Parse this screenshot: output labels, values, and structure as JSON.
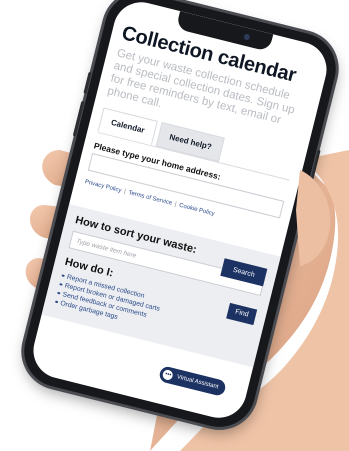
{
  "screen": {
    "title": "Collection calendar",
    "intro": "Get your waste collection schedule and special collection dates. Sign up for free reminders by text, email or phone call.",
    "tabs": [
      {
        "label": "Calendar",
        "active": true
      },
      {
        "label": "Need help?",
        "active": false
      }
    ],
    "address_label": "Please type your home address:",
    "address_input": {
      "value": "",
      "placeholder": ""
    },
    "links": [
      "Privacy Policy",
      "Terms of Service",
      "Cookie Policy"
    ],
    "search_label": "Search",
    "sort_title": "How to sort your waste:",
    "sort_placeholder": "Type waste item here",
    "how_title": "How do I:",
    "find_label": "Find",
    "how_items": [
      "Report a missed collection",
      "Report broken or damaged carts",
      "Send feedback or comments",
      "Order garbage tags"
    ],
    "assistant_label": "Virtual Assistant"
  },
  "colors": {
    "accent": "#1c3263",
    "link": "#2b4a8b",
    "phone_body": "#17181b",
    "skin": "#e8b89a"
  },
  "icons": [
    "chat-bubble-icon"
  ]
}
